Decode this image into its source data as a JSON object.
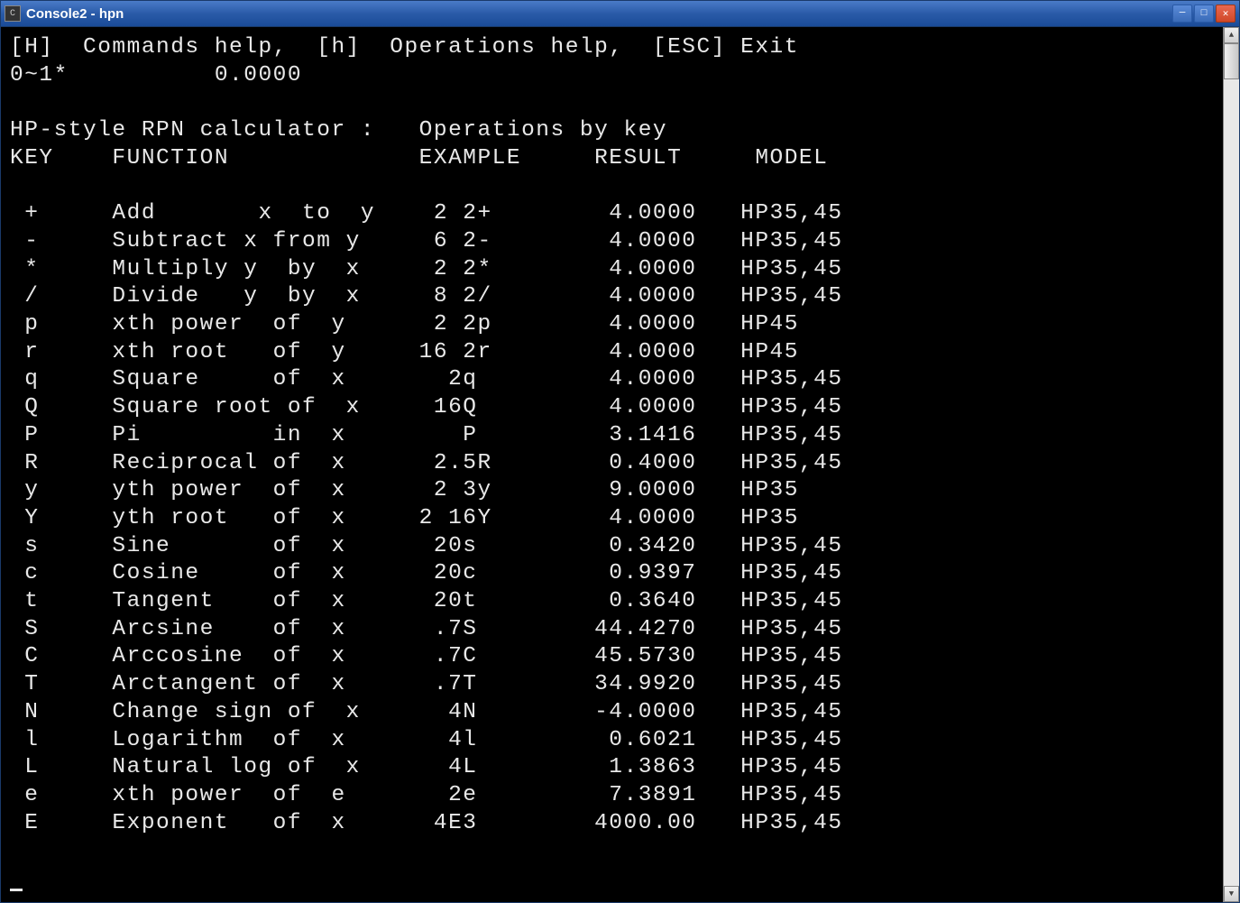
{
  "window": {
    "title": "Console2 - hpn"
  },
  "header": {
    "help_line": "[H]  Commands help,  [h]  Operations help,  [ESC] Exit",
    "stack_line": "0~1*          0.0000"
  },
  "title_line": "HP-style RPN calculator :   Operations by key",
  "columns": {
    "key": "KEY",
    "function": "FUNCTION",
    "example": "EXAMPLE",
    "result": "RESULT",
    "model": "MODEL"
  },
  "rows": [
    {
      "key": "+",
      "func": "Add       x  to  y",
      "ex": "  2 2+",
      "res": "  4.0000",
      "model": "HP35,45"
    },
    {
      "key": "-",
      "func": "Subtract x from y",
      "ex": "  6 2-",
      "res": "  4.0000",
      "model": "HP35,45"
    },
    {
      "key": "*",
      "func": "Multiply y  by  x",
      "ex": "  2 2*",
      "res": "  4.0000",
      "model": "HP35,45"
    },
    {
      "key": "/",
      "func": "Divide   y  by  x",
      "ex": "  8 2/",
      "res": "  4.0000",
      "model": "HP35,45"
    },
    {
      "key": "p",
      "func": "xth power  of  y",
      "ex": "  2 2p",
      "res": "  4.0000",
      "model": "HP45"
    },
    {
      "key": "r",
      "func": "xth root   of  y",
      "ex": " 16 2r",
      "res": "  4.0000",
      "model": "HP45"
    },
    {
      "key": "q",
      "func": "Square     of  x",
      "ex": "   2q ",
      "res": "  4.0000",
      "model": "HP35,45"
    },
    {
      "key": "Q",
      "func": "Square root of  x",
      "ex": "  16Q ",
      "res": "  4.0000",
      "model": "HP35,45"
    },
    {
      "key": "P",
      "func": "Pi         in  x",
      "ex": "    P ",
      "res": "  3.1416",
      "model": "HP35,45"
    },
    {
      "key": "R",
      "func": "Reciprocal of  x",
      "ex": "  2.5R",
      "res": "  0.4000",
      "model": "HP35,45"
    },
    {
      "key": "y",
      "func": "yth power  of  x",
      "ex": "  2 3y",
      "res": "  9.0000",
      "model": "HP35"
    },
    {
      "key": "Y",
      "func": "yth root   of  x",
      "ex": " 2 16Y",
      "res": "  4.0000",
      "model": "HP35"
    },
    {
      "key": "s",
      "func": "Sine       of  x",
      "ex": "  20s ",
      "res": "  0.3420",
      "model": "HP35,45"
    },
    {
      "key": "c",
      "func": "Cosine     of  x",
      "ex": "  20c ",
      "res": "  0.9397",
      "model": "HP35,45"
    },
    {
      "key": "t",
      "func": "Tangent    of  x",
      "ex": "  20t ",
      "res": "  0.3640",
      "model": "HP35,45"
    },
    {
      "key": "S",
      "func": "Arcsine    of  x",
      "ex": "  .7S ",
      "res": " 44.4270",
      "model": "HP35,45"
    },
    {
      "key": "C",
      "func": "Arccosine  of  x",
      "ex": "  .7C ",
      "res": " 45.5730",
      "model": "HP35,45"
    },
    {
      "key": "T",
      "func": "Arctangent of  x",
      "ex": "  .7T ",
      "res": " 34.9920",
      "model": "HP35,45"
    },
    {
      "key": "N",
      "func": "Change sign of  x",
      "ex": "   4N ",
      "res": " -4.0000",
      "model": "HP35,45"
    },
    {
      "key": "l",
      "func": "Logarithm  of  x",
      "ex": "   4l ",
      "res": "  0.6021",
      "model": "HP35,45"
    },
    {
      "key": "L",
      "func": "Natural log of  x",
      "ex": "   4L ",
      "res": "  1.3863",
      "model": "HP35,45"
    },
    {
      "key": "e",
      "func": "xth power  of  e",
      "ex": "   2e ",
      "res": "  7.3891",
      "model": "HP35,45"
    },
    {
      "key": "E",
      "func": "Exponent   of  x",
      "ex": "  4E3 ",
      "res": " 4000.00",
      "model": "HP35,45"
    }
  ]
}
